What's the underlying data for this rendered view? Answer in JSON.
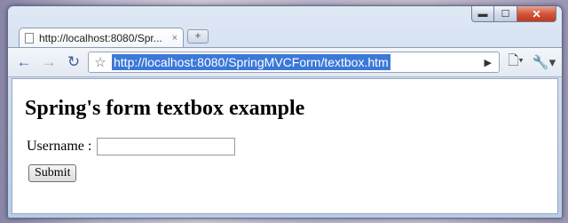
{
  "window": {
    "controls": {
      "minimize": "▬",
      "maximize": "☐",
      "close": "✕"
    }
  },
  "tabs": [
    {
      "title": "http://localhost:8080/Spr...",
      "close": "×"
    }
  ],
  "newtab_label": "+",
  "toolbar": {
    "back": "←",
    "forward": "→",
    "reload": "↻",
    "star": "☆",
    "url": "http://localhost:8080/SpringMVCForm/textbox.htm",
    "go": "▶",
    "page_menu": "🗋▾",
    "tools_menu": "🔧▾"
  },
  "page": {
    "heading": "Spring's form textbox example",
    "username_label": "Username :",
    "username_value": "",
    "submit_label": "Submit"
  }
}
